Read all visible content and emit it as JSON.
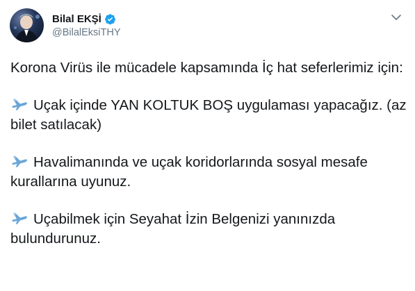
{
  "user": {
    "display_name": "Bilal EKŞİ",
    "handle": "@BilalEksiTHY",
    "verified": true,
    "avatar_icon": "profile-photo"
  },
  "menu": {
    "icon": "chevron-down-icon"
  },
  "tweet": {
    "intro": "Korona Virüs ile mücadele kapsamında İç hat seferlerimiz için:",
    "items": [
      {
        "icon": "airplane-emoji",
        "text": "Uçak içinde YAN KOLTUK BOŞ uygulaması yapacağız. (az bilet satılacak)"
      },
      {
        "icon": "airplane-emoji",
        "text": "Havalimanında ve uçak koridorlarında sosyal mesafe kurallarına uyunuz."
      },
      {
        "icon": "airplane-emoji",
        "text": "Uçabilmek için Seyahat İzin Belgenizi yanınızda bulundurunuz."
      }
    ]
  },
  "colors": {
    "text": "#14171a",
    "muted": "#657786",
    "verified_blue": "#1da1f2",
    "plane_blue": "#6aa6d8"
  }
}
